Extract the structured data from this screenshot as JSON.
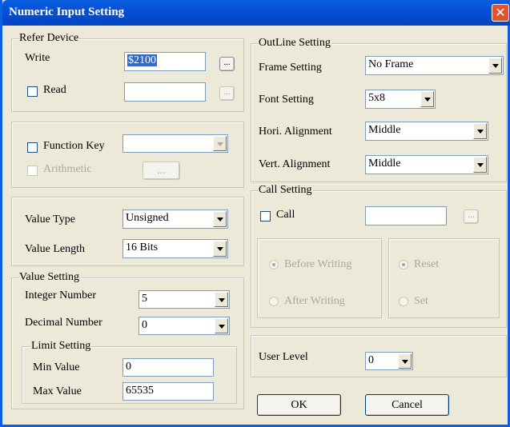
{
  "window": {
    "title": "Numeric Input Setting",
    "close": "✕"
  },
  "refer_device": {
    "title": "Refer Device",
    "write_label": "Write",
    "write_value": "$2100",
    "browse": "...",
    "read_label": "Read",
    "read_value": ""
  },
  "function": {
    "function_key_label": "Function Key",
    "function_key_value": "",
    "arithmetic_label": "Arithmetic",
    "arithmetic_button": "..."
  },
  "value_type": {
    "type_label": "Value Type",
    "type_value": "Unsigned",
    "length_label": "Value Length",
    "length_value": "16 Bits"
  },
  "value_setting": {
    "title": "Value Setting",
    "integer_label": "Integer Number",
    "integer_value": "5",
    "decimal_label": "Decimal Number",
    "decimal_value": "0"
  },
  "limit_setting": {
    "title": "Limit Setting",
    "min_label": "Min Value",
    "min_value": "0",
    "max_label": "Max Value",
    "max_value": "65535"
  },
  "outline": {
    "title": "OutLine Setting",
    "frame_label": "Frame Setting",
    "frame_value": "No Frame",
    "font_label": "Font Setting",
    "font_value": "5x8",
    "hori_label": "Hori. Alignment",
    "hori_value": "Middle",
    "vert_label": "Vert. Alignment",
    "vert_value": "Middle"
  },
  "call_setting": {
    "title": "Call Setting",
    "call_label": "Call",
    "call_value": "",
    "browse": "...",
    "before_writing": "Before Writing",
    "after_writing": "After Writing",
    "reset": "Reset",
    "set": "Set"
  },
  "user_level": {
    "label": "User Level",
    "value": "0"
  },
  "buttons": {
    "ok": "OK",
    "cancel": "Cancel"
  }
}
